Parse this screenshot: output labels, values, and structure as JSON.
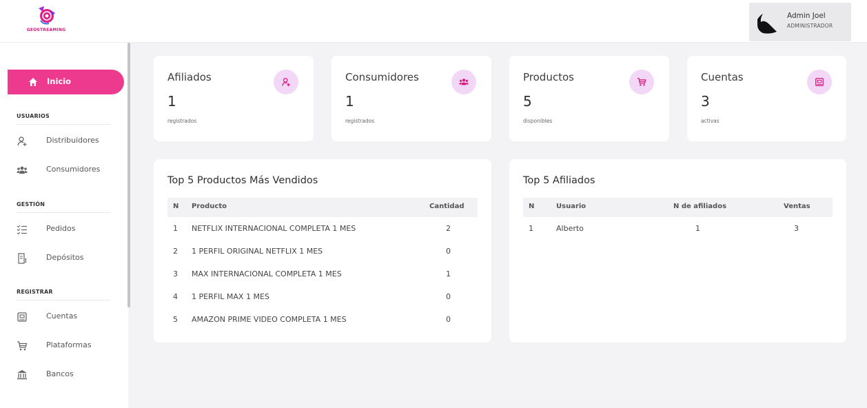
{
  "app": {
    "logo_text": "GEOSTREAMING"
  },
  "user": {
    "name": "Admin Joel",
    "role": "ADMINISTRADOR"
  },
  "sidebar": {
    "active": {
      "label": "Inicio",
      "icon": "home-icon"
    },
    "sections": [
      {
        "title": "USUARIOS",
        "items": [
          {
            "label": "Distribuidores",
            "icon": "user-plus-icon"
          },
          {
            "label": "Consumidores",
            "icon": "users-icon"
          }
        ]
      },
      {
        "title": "GESTIÓN",
        "items": [
          {
            "label": "Pedidos",
            "icon": "list-icon"
          },
          {
            "label": "Depósitos",
            "icon": "receipt-icon"
          }
        ]
      },
      {
        "title": "REGISTRAR",
        "items": [
          {
            "label": "Cuentas",
            "icon": "account-box-icon"
          },
          {
            "label": "Plataformas",
            "icon": "cart-icon"
          },
          {
            "label": "Bancos",
            "icon": "bank-icon"
          }
        ]
      }
    ]
  },
  "stats": [
    {
      "title": "Afiliados",
      "value": "1",
      "subtitle": "registrados",
      "icon": "user-plus-icon"
    },
    {
      "title": "Consumidores",
      "value": "1",
      "subtitle": "registrados",
      "icon": "users-icon"
    },
    {
      "title": "Productos",
      "value": "5",
      "subtitle": "disponibles",
      "icon": "cart-icon"
    },
    {
      "title": "Cuentas",
      "value": "3",
      "subtitle": "activas",
      "icon": "account-box-icon"
    }
  ],
  "top_products": {
    "title": "Top 5 Productos Más Vendidos",
    "columns": [
      "N",
      "Producto",
      "Cantidad"
    ],
    "rows": [
      [
        "1",
        "NETFLIX INTERNACIONAL COMPLETA 1 MES",
        "2"
      ],
      [
        "2",
        "1 PERFIL ORIGINAL NETFLIX 1 MES",
        "0"
      ],
      [
        "3",
        "MAX INTERNACIONAL COMPLETA 1 MES",
        "1"
      ],
      [
        "4",
        "1 PERFIL MAX 1 MES",
        "0"
      ],
      [
        "5",
        "AMAZON PRIME VIDEO COMPLETA 1 MES",
        "0"
      ]
    ]
  },
  "top_affiliates": {
    "title": "Top 5 Afiliados",
    "columns": [
      "N",
      "Usuario",
      "N de afiliados",
      "Ventas"
    ],
    "rows": [
      [
        "1",
        "Alberto",
        "1",
        "3"
      ]
    ]
  },
  "colors": {
    "accent": "#ee3a8e",
    "icon_bg": "#f3d7f6",
    "icon_fg": "#d6197d"
  }
}
